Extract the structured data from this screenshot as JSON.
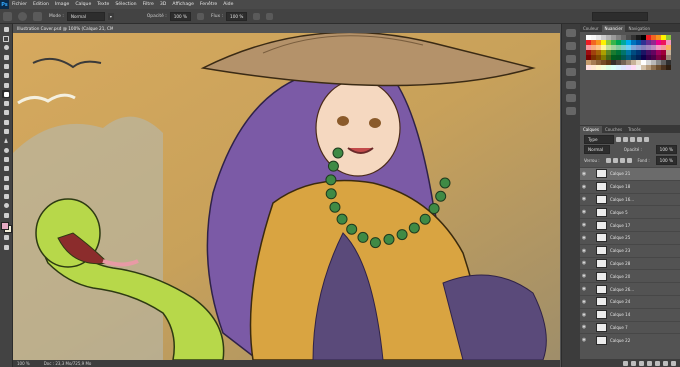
{
  "menubar": {
    "logo": "Ps",
    "items": [
      "Fichier",
      "Edition",
      "Image",
      "Calque",
      "Texte",
      "Sélection",
      "Filtre",
      "3D",
      "Affichage",
      "Fenêtre",
      "Aide"
    ]
  },
  "options_bar": {
    "mode_label": "Mode :",
    "mode_value": "Normal",
    "opacity_label": "Opacité :",
    "opacity_value": "100 %",
    "flow_label": "Flux :",
    "flow_value": "100 %"
  },
  "document": {
    "tab_title": "Illustration Cover.psd @ 100% (Calque 21, CMJN/8)",
    "status_zoom": "100 %",
    "status_doc": "Doc : 23,3 Mo/725,9 Mo"
  },
  "panel": {
    "top_tabs": [
      "Couleur",
      "Nuancier",
      "Navigation"
    ],
    "active_top_tab": "Nuancier",
    "swatch_colors": [
      "#ffffff",
      "#f7f7f7",
      "#e6e6e6",
      "#cccccc",
      "#b3b3b3",
      "#999999",
      "#808080",
      "#666666",
      "#4d4d4d",
      "#333333",
      "#1a1a1a",
      "#000000",
      "#ed1c24",
      "#f26522",
      "#f7941d",
      "#fff200",
      "#8dc63f",
      "#ed1c24",
      "#f26522",
      "#f7941d",
      "#fff200",
      "#8dc63f",
      "#39b54a",
      "#00a651",
      "#00a99d",
      "#00aeef",
      "#0072bc",
      "#0054a6",
      "#2e3192",
      "#662d91",
      "#92278f",
      "#ec008c",
      "#ed145b",
      "#f49ac1",
      "#f6989d",
      "#f9ad81",
      "#fdc68a",
      "#fff799",
      "#c4df9b",
      "#a3d39c",
      "#82ca9c",
      "#7accc8",
      "#6dcff6",
      "#7da7d9",
      "#8393ca",
      "#8781bd",
      "#a187be",
      "#bd8cbf",
      "#f49ac1",
      "#f5989d",
      "#fbaf5d",
      "#9e0b0f",
      "#a0410d",
      "#a36209",
      "#aba000",
      "#598527",
      "#1a7b30",
      "#007236",
      "#00746b",
      "#0076a3",
      "#004b80",
      "#003471",
      "#1b1464",
      "#440e62",
      "#630460",
      "#9e005d",
      "#9e0039",
      "#c7b299",
      "#790000",
      "#7b2e00",
      "#7d4900",
      "#827b00",
      "#406618",
      "#005e20",
      "#005826",
      "#005952",
      "#005b7f",
      "#003663",
      "#002157",
      "#0d004c",
      "#32004b",
      "#4b0049",
      "#7b0046",
      "#7a0026",
      "#998675",
      "#c69c6d",
      "#a67c52",
      "#8c6239",
      "#754c24",
      "#603913",
      "#362f2d",
      "#534741",
      "#736357",
      "#998675",
      "#c7b299",
      "#e6dbc8",
      "#ffffff",
      "#d7d7d7",
      "#b8b8b8",
      "#8a8a8a",
      "#5e5e5e",
      "#2f2f2f",
      "#ffe0e0",
      "#ffe8d0",
      "#fff6cc",
      "#f2ffd9",
      "#dcffe4",
      "#d9fff8",
      "#d9f2ff",
      "#dde4ff",
      "#ecdcff",
      "#ffdcf5",
      "#f0f0f0",
      "#d4c1a8",
      "#b59b7c",
      "#8d7050",
      "#6a4d2f",
      "#4b3320",
      "#2e1e10"
    ],
    "layer_tabs": [
      "Calques",
      "Couches",
      "Tracés"
    ],
    "active_layer_tab": "Calques",
    "filter_kind": "Type",
    "blend_mode": "Normal",
    "opacity_label": "Opacité :",
    "opacity_value": "100 %",
    "lock_label": "Verrou :",
    "fill_label": "Fond :",
    "fill_value": "100 %",
    "layers": [
      {
        "name": "Calque 21",
        "selected": true
      },
      {
        "name": "Calque 18",
        "selected": false
      },
      {
        "name": "Calque 16...",
        "selected": false
      },
      {
        "name": "Calque 5",
        "selected": false
      },
      {
        "name": "Calque 17",
        "selected": false
      },
      {
        "name": "Calque 25",
        "selected": false
      },
      {
        "name": "Calque 23",
        "selected": false
      },
      {
        "name": "Calque 28",
        "selected": false
      },
      {
        "name": "Calque 20",
        "selected": false
      },
      {
        "name": "Calque 26...",
        "selected": false
      },
      {
        "name": "Calque 24",
        "selected": false
      },
      {
        "name": "Calque 14",
        "selected": false
      },
      {
        "name": "Calque 7",
        "selected": false
      },
      {
        "name": "Calque 22",
        "selected": false
      }
    ]
  },
  "colors": {
    "foreground": "#e4a9c2",
    "background": "#f2eed9",
    "hair": "#7b5aa6",
    "robe": "#d9a441",
    "snake": "#b7d84a",
    "hat": "#b4926a"
  }
}
